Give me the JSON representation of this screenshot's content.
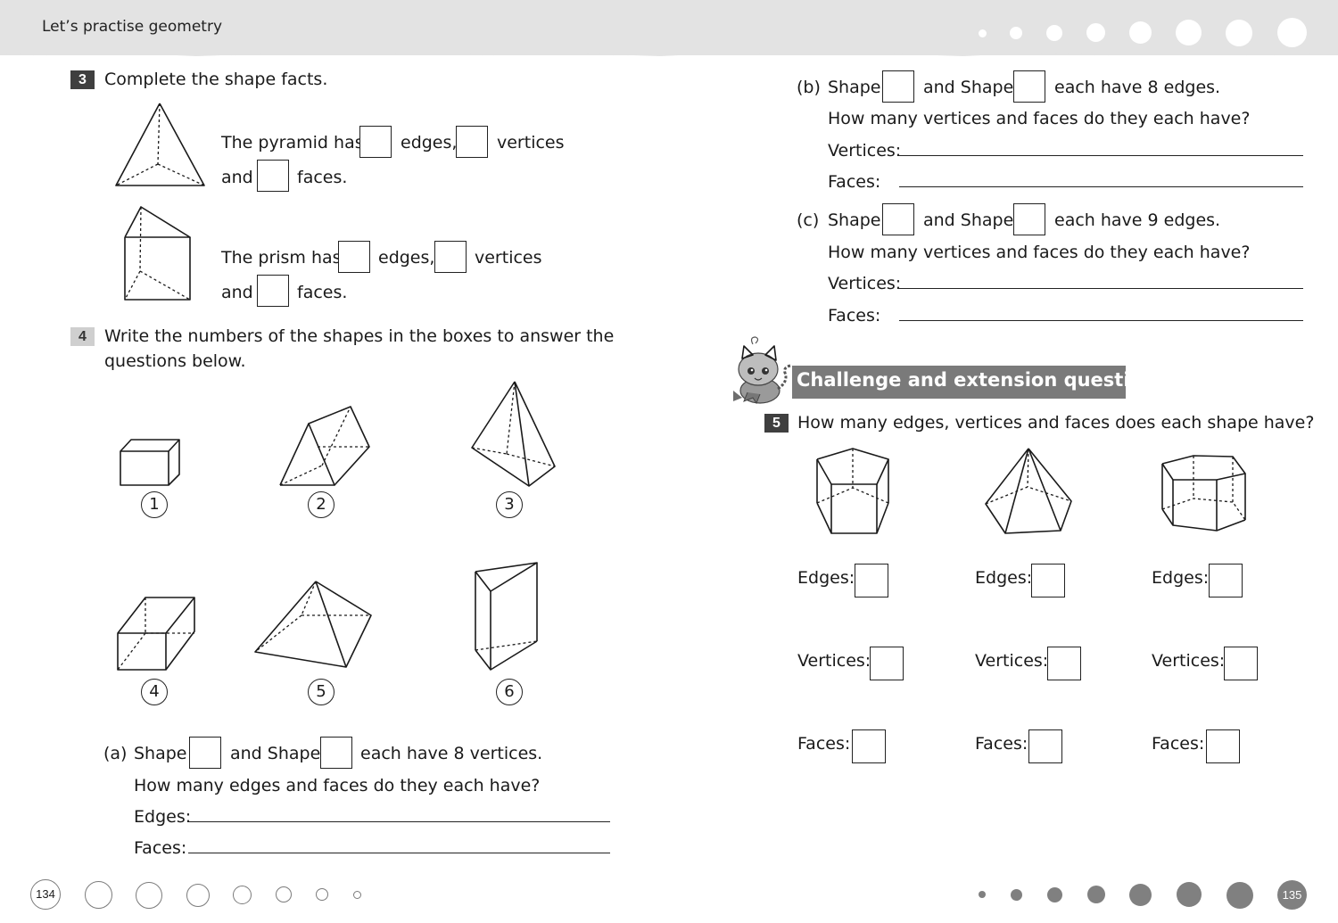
{
  "header": {
    "title": "Let’s practise geometry",
    "dot_count": 8
  },
  "q3": {
    "number": "3",
    "prompt": "Complete the shape facts.",
    "pyramid": {
      "t1": "The pyramid has",
      "t2": "edges,",
      "t3": "vertices",
      "t4": "and",
      "t5": "faces."
    },
    "prism": {
      "t1": "The prism has",
      "t2": "edges,",
      "t3": "vertices",
      "t4": "and",
      "t5": "faces."
    }
  },
  "q4": {
    "number": "4",
    "prompt_line1": "Write the numbers of the shapes in the boxes to answer the",
    "prompt_line2": "questions below.",
    "shapes": [
      {
        "label": "1",
        "name": "cube"
      },
      {
        "label": "2",
        "name": "triangular prism"
      },
      {
        "label": "3",
        "name": "triangular-based pyramid"
      },
      {
        "label": "4",
        "name": "cuboid"
      },
      {
        "label": "5",
        "name": "square-based pyramid"
      },
      {
        "label": "6",
        "name": "triangular prism"
      }
    ],
    "a": {
      "letter": "(a)",
      "shape": "Shape",
      "and_shape": "and Shape",
      "tail": "each have 8 vertices.",
      "question": "How many edges and faces do they each have?",
      "ans1": "Edges:",
      "ans2": "Faces:"
    },
    "b": {
      "letter": "(b)",
      "shape": "Shape",
      "and_shape": "and Shape",
      "tail": "each have 8 edges.",
      "question": "How many vertices and faces do they each have?",
      "ans1": "Vertices:",
      "ans2": "Faces:"
    },
    "c": {
      "letter": "(c)",
      "shape": "Shape",
      "and_shape": "and Shape",
      "tail": "each have 9 edges.",
      "question": "How many vertices and faces do they each have?",
      "ans1": "Vertices:",
      "ans2": "Faces:"
    }
  },
  "challenge": {
    "banner": "Challenge and extension question",
    "number": "5",
    "prompt": "How many edges, vertices and faces does each shape have?",
    "shapes": [
      "pentagonal prism",
      "pentagonal pyramid",
      "hexagonal prism"
    ],
    "labels": {
      "edges": "Edges:",
      "vertices": "Vertices:",
      "faces": "Faces:"
    }
  },
  "footer": {
    "left_page": "134",
    "right_page": "135"
  }
}
